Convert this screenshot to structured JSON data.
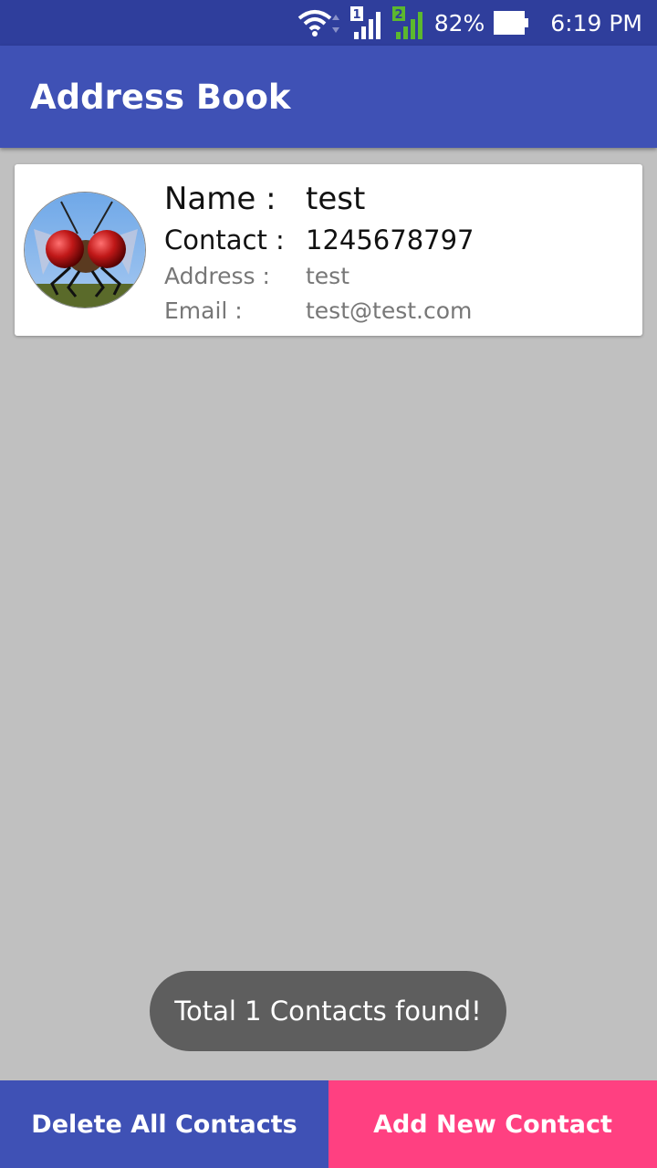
{
  "status_bar": {
    "battery_percent": "82%",
    "time": "6:19 PM",
    "icons": [
      "wifi-icon",
      "sim1-signal-icon",
      "sim2-signal-icon",
      "battery-icon"
    ]
  },
  "app_bar": {
    "title": "Address Book"
  },
  "contacts": [
    {
      "name_label": "Name :",
      "name": "test",
      "contact_label": "Contact :",
      "contact": "1245678797",
      "address_label": "Address :",
      "address": "test",
      "email_label": "Email :",
      "email": "test@test.com",
      "avatar_icon": "fly-avatar-icon"
    }
  ],
  "toast": {
    "text": "Total 1 Contacts found!"
  },
  "buttons": {
    "delete_all": "Delete All Contacts",
    "add_new": "Add New Contact"
  },
  "colors": {
    "primary": "#3f51b5",
    "primary_dark": "#2f3e9c",
    "accent": "#ff4081",
    "background": "#c0c0c0"
  }
}
